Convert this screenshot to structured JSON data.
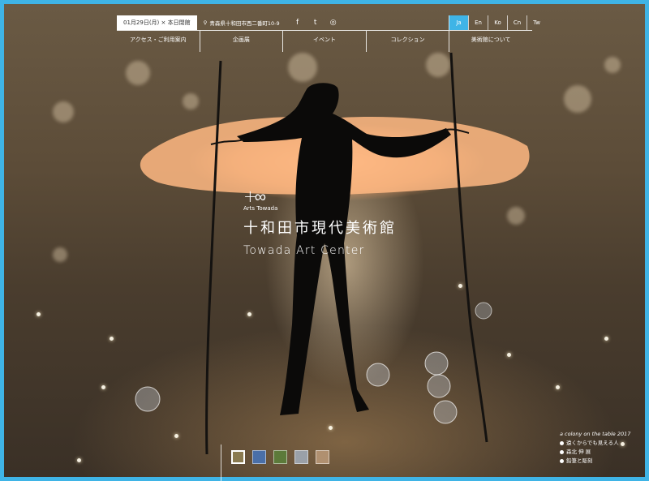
{
  "header": {
    "hours": "01月29日(月) × 本日閉館",
    "address": "青森県十和田市西二番町10-9",
    "social_icons": [
      "facebook-icon",
      "twitter-icon",
      "instagram-icon"
    ],
    "social_glyphs": [
      "f",
      "t",
      "◎"
    ],
    "languages": [
      {
        "code": "Ja",
        "active": true
      },
      {
        "code": "En",
        "active": false
      },
      {
        "code": "Ko",
        "active": false
      },
      {
        "code": "Cn",
        "active": false
      },
      {
        "code": "Tw",
        "active": false
      }
    ]
  },
  "menu": [
    "アクセス・ご利用案内",
    "企画展",
    "イベント",
    "コレクション",
    "美術館について"
  ],
  "logo": {
    "mark": "+∞",
    "sub": "Arts Towada",
    "name_ja": "十和田市現代美術館",
    "name_en": "Towada Art Center"
  },
  "caption": {
    "en": "a colony on the table 2017",
    "line1": "遠くからでも見える人",
    "line2": "森北 伸 展",
    "line3": "鉛筆と彫刻"
  },
  "thumbnails": [
    {
      "color": "#8a7a50",
      "active": true
    },
    {
      "color": "#4a6fa8",
      "active": false
    },
    {
      "color": "#5c7a3a",
      "active": false
    },
    {
      "color": "#9aa0a8",
      "active": false
    },
    {
      "color": "#b09070",
      "active": false
    }
  ],
  "colors": {
    "accent": "#3fb4e6"
  }
}
